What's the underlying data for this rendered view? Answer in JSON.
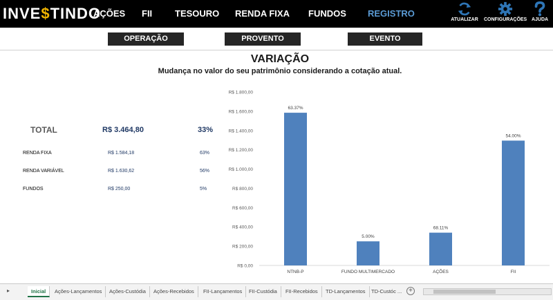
{
  "app": {
    "logo_prefix": "INVE",
    "logo_dollar": "$",
    "logo_suffix": "TINDO"
  },
  "nav": [
    {
      "label": "AÇÕES"
    },
    {
      "label": "FII"
    },
    {
      "label": "TESOURO"
    },
    {
      "label": "RENDA FIXA"
    },
    {
      "label": "FUNDOS"
    },
    {
      "label": "REGISTRO",
      "active": true
    }
  ],
  "tools": [
    {
      "label": "ATUALIZAR",
      "icon": "refresh-icon"
    },
    {
      "label": "CONFIGURAÇÕES",
      "icon": "gear-icon"
    },
    {
      "label": "AJUDA",
      "icon": "question-icon"
    }
  ],
  "subnav": [
    {
      "label": "OPERAÇÃO"
    },
    {
      "label": "PROVENTO"
    },
    {
      "label": "EVENTO"
    }
  ],
  "page": {
    "title": "VARIAÇÃO",
    "subtitle": "Mudança no valor do seu patrimônio considerando a cotação atual."
  },
  "summary": {
    "total_label": "TOTAL",
    "total_value": "R$ 3.464,80",
    "total_pct": "33%",
    "rows": [
      {
        "label": "RENDA FIXA",
        "value": "R$ 1.584,18",
        "pct": "63%"
      },
      {
        "label": "RENDA VARIÁVEL",
        "value": "R$ 1.630,62",
        "pct": "56%"
      },
      {
        "label": "FUNDOS",
        "value": "R$ 250,00",
        "pct": "5%"
      }
    ]
  },
  "chart_data": {
    "type": "bar",
    "categories": [
      "NTNB-P",
      "FUNDO MULTIMERCADO",
      "AÇÕES",
      "FII"
    ],
    "values": [
      1584.18,
      250.0,
      340.0,
      1295.0
    ],
    "data_labels": [
      "63.37%",
      "5.00%",
      "68.11%",
      "54.00%"
    ],
    "ylim": [
      0,
      1800
    ],
    "yticks": [
      0,
      200,
      400,
      600,
      800,
      1000,
      1200,
      1400,
      1600,
      1800
    ],
    "ytick_labels": [
      "R$ 0,00",
      "R$ 200,00",
      "R$ 400,00",
      "R$ 600,00",
      "R$ 800,00",
      "R$ 1.000,00",
      "R$ 1.200,00",
      "R$ 1.400,00",
      "R$ 1.600,00",
      "R$ 1.800,00"
    ],
    "bar_color": "#4f81bd",
    "grid": false
  },
  "sheet_tabs": [
    {
      "label": "Inicial",
      "active": true
    },
    {
      "label": "Ações-Lançamentos"
    },
    {
      "label": "Ações-Custódia"
    },
    {
      "label": "Ações-Recebidos"
    },
    {
      "label": "FII-Lançamentos"
    },
    {
      "label": "FII-Custódia"
    },
    {
      "label": "FII-Recebidos"
    },
    {
      "label": "TD-Lançamentos"
    },
    {
      "label": "TD-Custóc ..."
    }
  ],
  "colors": {
    "topbar": "#000000",
    "nav_active": "#5b9bd5",
    "tool_icon": "#2e75b6",
    "logo_dollar": "#f0b400"
  }
}
